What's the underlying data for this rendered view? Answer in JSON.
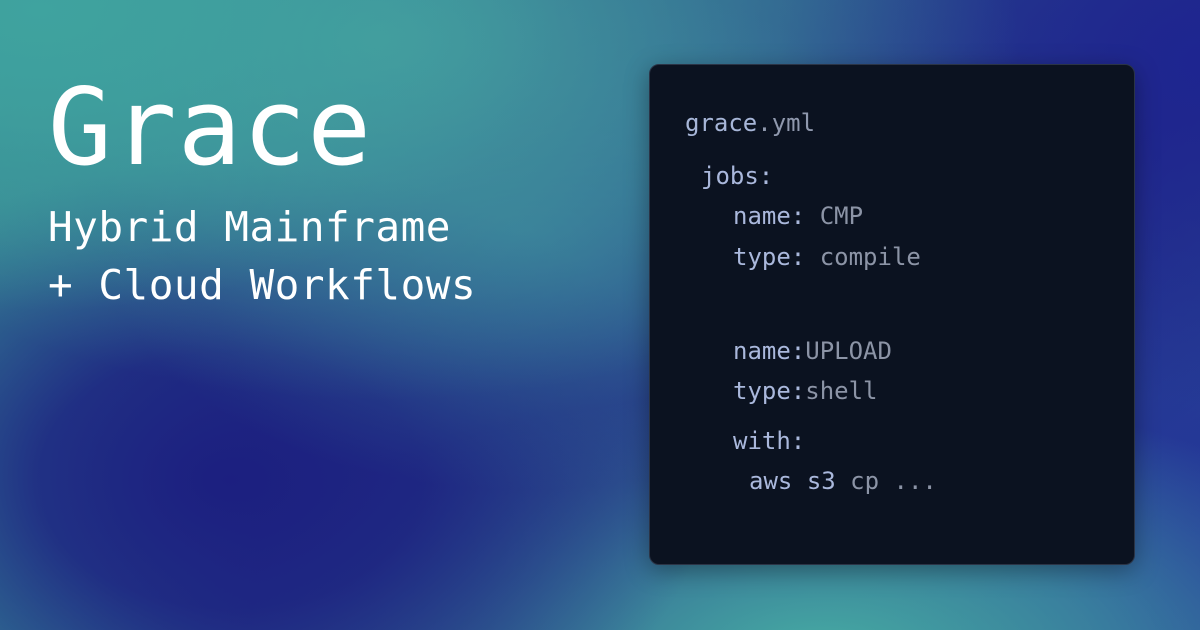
{
  "hero": {
    "title": "Grace",
    "subtitle_line1": "Hybrid Mainframe",
    "subtitle_line2": "+ Cloud Workflows"
  },
  "code": {
    "file_name": "grace",
    "file_ext": ".yml",
    "jobs_key": "jobs:",
    "job1": {
      "name_key": "name:",
      "name_value": "CMP",
      "type_key": "type:",
      "type_value": "compile"
    },
    "job2": {
      "name_key": "name:",
      "name_value": "UPLOAD",
      "type_key": "type:",
      "type_value": "shell",
      "with_key": "with:",
      "cmd_aws": "aws",
      "cmd_s3": "s3",
      "cmd_rest": "cp ..."
    }
  },
  "colors": {
    "card_background": "#0b1220",
    "key_color": "#aab8dc",
    "value_color": "#8c94a6",
    "hero_text": "#ffffff"
  }
}
